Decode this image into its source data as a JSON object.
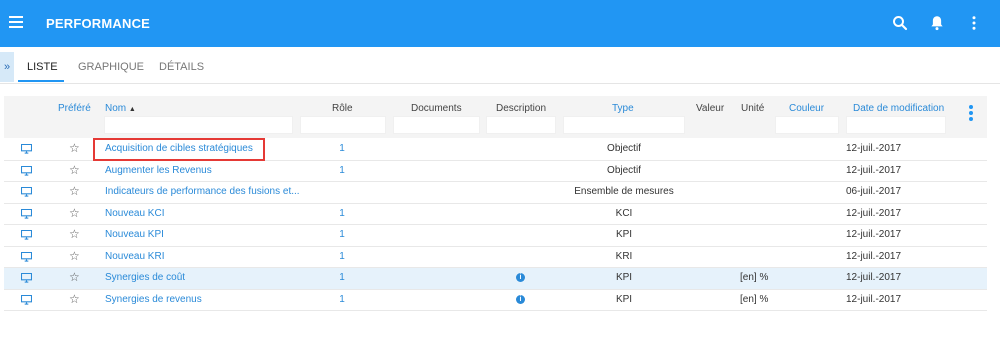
{
  "app": {
    "title": "PERFORMANCE"
  },
  "tabs": [
    {
      "label": "LISTE"
    },
    {
      "label": "GRAPHIQUE"
    },
    {
      "label": "DÉTAILS"
    }
  ],
  "columns": {
    "prefere": "Préféré",
    "nom": "Nom",
    "sort_indicator": "▲",
    "role": "Rôle",
    "documents": "Documents",
    "description": "Description",
    "type": "Type",
    "valeur": "Valeur",
    "unite": "Unité",
    "couleur": "Couleur",
    "date": "Date de modification"
  },
  "rows": [
    {
      "nom": "Acquisition de cibles stratégiques",
      "role": "1",
      "type": "Objectif",
      "unite": "",
      "date": "12-juil.-2017",
      "info": false,
      "highlight": false
    },
    {
      "nom": "Augmenter les Revenus",
      "role": "1",
      "type": "Objectif",
      "unite": "",
      "date": "12-juil.-2017",
      "info": false,
      "highlight": false
    },
    {
      "nom": "Indicateurs de performance des fusions et...",
      "role": "",
      "type": "Ensemble de mesures",
      "unite": "",
      "date": "06-juil.-2017",
      "info": false,
      "highlight": false
    },
    {
      "nom": "Nouveau KCI",
      "role": "1",
      "type": "KCI",
      "unite": "",
      "date": "12-juil.-2017",
      "info": false,
      "highlight": false
    },
    {
      "nom": "Nouveau KPI",
      "role": "1",
      "type": "KPI",
      "unite": "",
      "date": "12-juil.-2017",
      "info": false,
      "highlight": false
    },
    {
      "nom": "Nouveau KRI",
      "role": "1",
      "type": "KRI",
      "unite": "",
      "date": "12-juil.-2017",
      "info": false,
      "highlight": false
    },
    {
      "nom": "Synergies de coût",
      "role": "1",
      "type": "KPI",
      "unite": "[en] %",
      "date": "12-juil.-2017",
      "info": true,
      "highlight": true
    },
    {
      "nom": "Synergies de revenus",
      "role": "1",
      "type": "KPI",
      "unite": "[en] %",
      "date": "12-juil.-2017",
      "info": true,
      "highlight": false
    }
  ],
  "colors": {
    "appbar": "#2196f3",
    "link": "#2a8ad8",
    "highlight_row": "#e6f2fb",
    "callout": "#e53935"
  },
  "icons": {
    "menu": "hamburger-icon",
    "search": "search-icon",
    "notifications": "bell-icon",
    "more": "more-vert-icon",
    "row_view": "monitor-icon",
    "favorite": "star-outline-icon",
    "info": "info-icon",
    "expand": "double-chevron-right-icon"
  }
}
